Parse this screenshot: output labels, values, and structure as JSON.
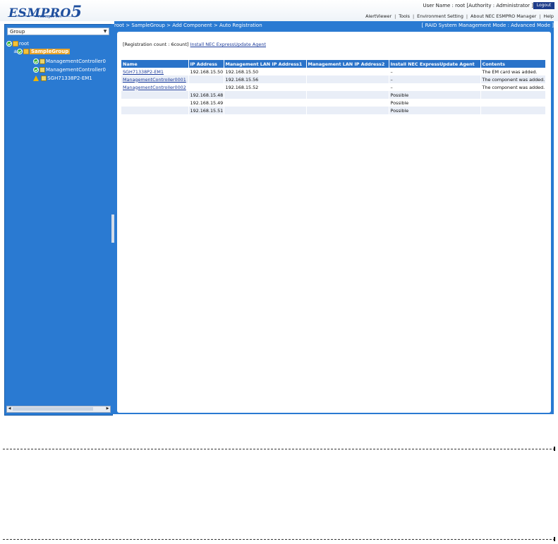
{
  "header": {
    "logo_text": "ESMPRO",
    "logo_number": "5",
    "logo_sub": "Manager Ver.",
    "user_label": "User Name : root  [Authority : Administrator ]",
    "logout_label": "Logout",
    "nav": [
      "AlertViewer",
      "Tools",
      "Environment Setting",
      "About NEC ESMPRO Manager",
      "Help"
    ]
  },
  "sidebar": {
    "group_select": "Group",
    "tree": [
      {
        "label": "root",
        "level": 0
      },
      {
        "label": "SampleGroup",
        "level": 1,
        "selected": true
      },
      {
        "label": "ManagementController0",
        "level": 2
      },
      {
        "label": "ManagementController0",
        "level": 2
      },
      {
        "label": "SGH71338P2-EM1",
        "level": 2,
        "status": "warning"
      }
    ]
  },
  "main": {
    "breadcrumb": "root > SampleGroup > Add Component > Auto Registration",
    "mode": "[ RAID System Management Mode : Advanced Mode ]",
    "registration_count": "[Registration count : 6count]",
    "install_link": "Install NEC ExpressUpdate Agent",
    "columns": [
      "Name",
      "IP Address",
      "Management LAN IP Address1",
      "Management LAN IP Address2",
      "Install NEC ExpressUpdate Agent",
      "Contents"
    ],
    "rows": [
      [
        "SGH71338P2-EM1",
        "192.168.15.50",
        "192.168.15.50",
        "",
        "–",
        "The EM card was added."
      ],
      [
        "ManagementController0001",
        "",
        "192.168.15.56",
        "",
        "–",
        "The component was added."
      ],
      [
        "ManagementController0002",
        "",
        "192.168.15.52",
        "",
        "–",
        "The component was added."
      ],
      [
        "",
        "192.168.15.48",
        "",
        "",
        "Possible",
        ""
      ],
      [
        "",
        "192.168.15.49",
        "",
        "",
        "Possible",
        ""
      ],
      [
        "",
        "192.168.15.51",
        "",
        "",
        "Possible",
        ""
      ]
    ]
  },
  "colors": {
    "accent_blue": "#2a7ad2",
    "header_blue": "#2a73c9",
    "link": "#1a3a9a",
    "selected_node": "#e9a42a"
  }
}
